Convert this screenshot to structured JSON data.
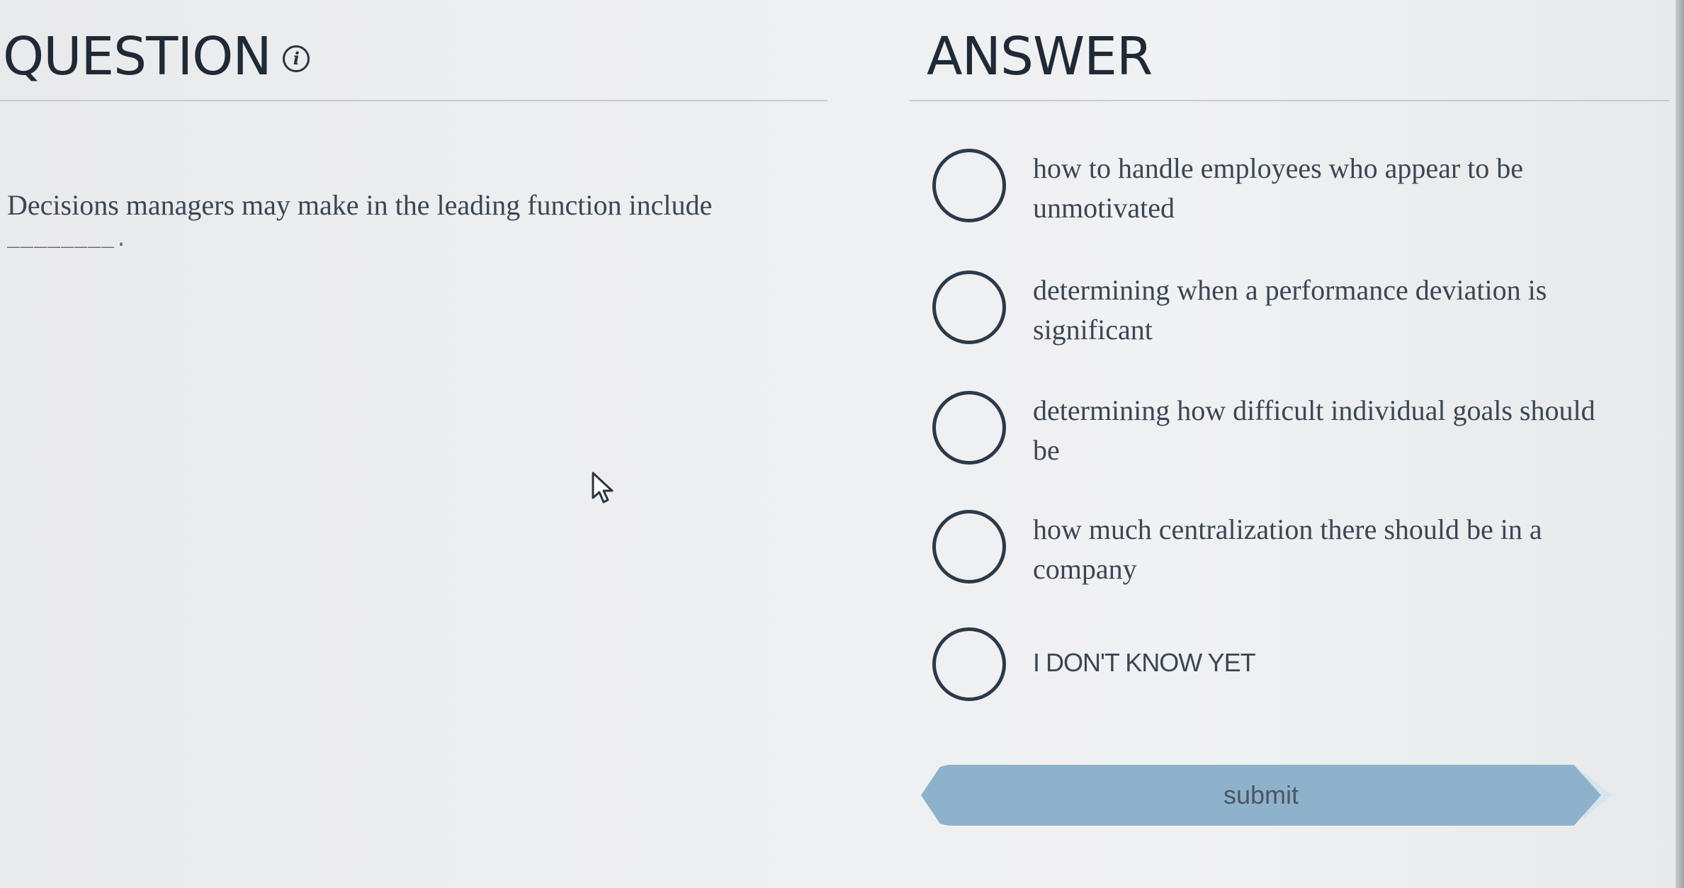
{
  "question_panel": {
    "heading": "QUESTION",
    "info_icon_glyph": "i",
    "text": "Decisions managers may make in the leading function include",
    "blank": "________."
  },
  "answer_panel": {
    "heading": "ANSWER",
    "options": [
      {
        "label": "how to handle employees who appear to be unmotivated"
      },
      {
        "label": "determining when a performance deviation is significant"
      },
      {
        "label": "determining how difficult individual goals should be"
      },
      {
        "label": "how much centralization there should be in a company"
      },
      {
        "label": "I DON'T KNOW YET"
      }
    ],
    "submit_label": "submit"
  },
  "colors": {
    "submit_fill": "#8fb2cc",
    "radio_stroke": "#2b3a48",
    "text": "#3a4654"
  },
  "icons": {
    "info": "info-icon",
    "cursor": "mouse-pointer-icon"
  }
}
